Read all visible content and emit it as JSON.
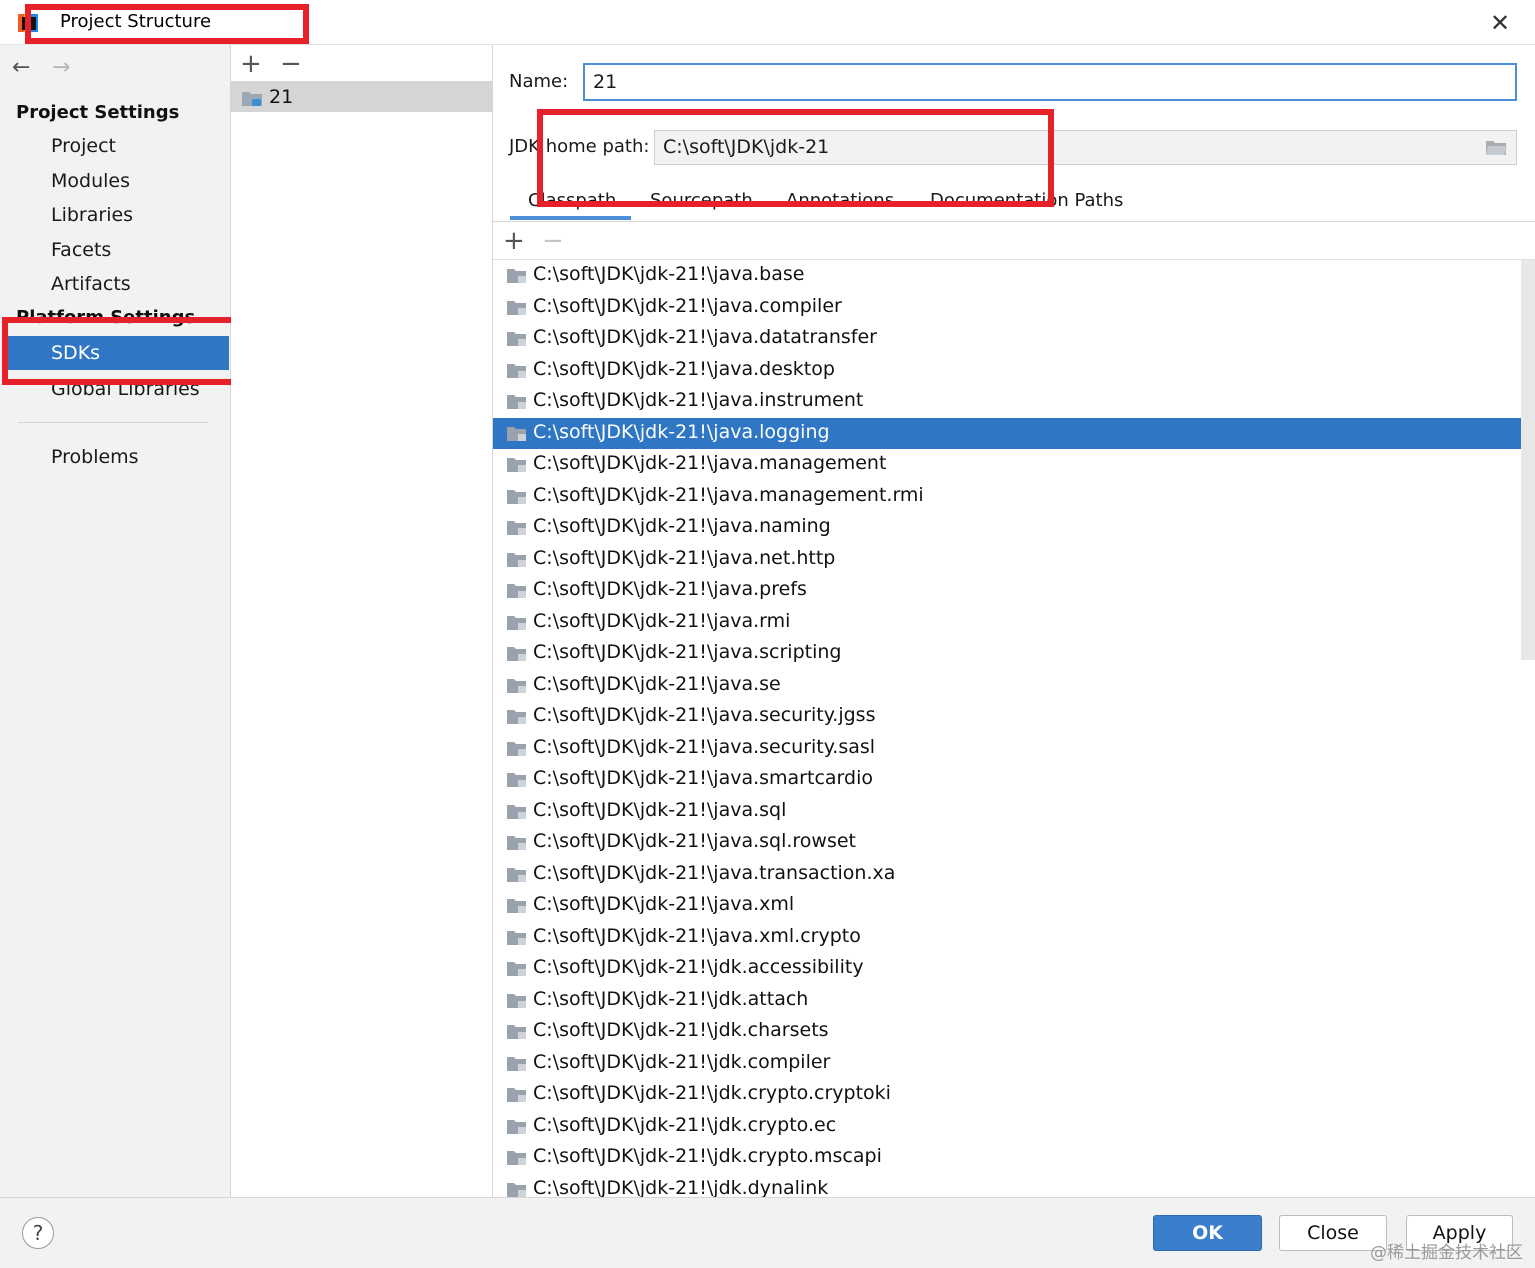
{
  "window": {
    "title": "Project Structure",
    "close_glyph": "✕"
  },
  "nav": {
    "back": "←",
    "forward": "→"
  },
  "sidebar": {
    "project_settings_heading": "Project Settings",
    "items": [
      {
        "label": "Project"
      },
      {
        "label": "Modules"
      },
      {
        "label": "Libraries"
      },
      {
        "label": "Facets"
      },
      {
        "label": "Artifacts"
      }
    ],
    "platform_heading": "Platform Settings",
    "platform_items": [
      {
        "label": "SDKs",
        "selected": true
      },
      {
        "label": "Global Libraries"
      }
    ],
    "problems": "Problems"
  },
  "sdk_list": {
    "add": "+",
    "remove": "−",
    "items": [
      {
        "label": "21"
      }
    ]
  },
  "detail": {
    "name_label": "Name:",
    "name_value": "21",
    "jdk_home_label": "JDK home path:",
    "jdk_home_value": "C:\\soft\\JDK\\jdk-21",
    "tabs": [
      "Classpath",
      "Sourcepath",
      "Annotations",
      "Documentation Paths"
    ],
    "active_tab": "Classpath",
    "list_add": "+",
    "list_remove": "−",
    "classpath": [
      "C:\\soft\\JDK\\jdk-21!\\java.base",
      "C:\\soft\\JDK\\jdk-21!\\java.compiler",
      "C:\\soft\\JDK\\jdk-21!\\java.datatransfer",
      "C:\\soft\\JDK\\jdk-21!\\java.desktop",
      "C:\\soft\\JDK\\jdk-21!\\java.instrument",
      "C:\\soft\\JDK\\jdk-21!\\java.logging",
      "C:\\soft\\JDK\\jdk-21!\\java.management",
      "C:\\soft\\JDK\\jdk-21!\\java.management.rmi",
      "C:\\soft\\JDK\\jdk-21!\\java.naming",
      "C:\\soft\\JDK\\jdk-21!\\java.net.http",
      "C:\\soft\\JDK\\jdk-21!\\java.prefs",
      "C:\\soft\\JDK\\jdk-21!\\java.rmi",
      "C:\\soft\\JDK\\jdk-21!\\java.scripting",
      "C:\\soft\\JDK\\jdk-21!\\java.se",
      "C:\\soft\\JDK\\jdk-21!\\java.security.jgss",
      "C:\\soft\\JDK\\jdk-21!\\java.security.sasl",
      "C:\\soft\\JDK\\jdk-21!\\java.smartcardio",
      "C:\\soft\\JDK\\jdk-21!\\java.sql",
      "C:\\soft\\JDK\\jdk-21!\\java.sql.rowset",
      "C:\\soft\\JDK\\jdk-21!\\java.transaction.xa",
      "C:\\soft\\JDK\\jdk-21!\\java.xml",
      "C:\\soft\\JDK\\jdk-21!\\java.xml.crypto",
      "C:\\soft\\JDK\\jdk-21!\\jdk.accessibility",
      "C:\\soft\\JDK\\jdk-21!\\jdk.attach",
      "C:\\soft\\JDK\\jdk-21!\\jdk.charsets",
      "C:\\soft\\JDK\\jdk-21!\\jdk.compiler",
      "C:\\soft\\JDK\\jdk-21!\\jdk.crypto.cryptoki",
      "C:\\soft\\JDK\\jdk-21!\\jdk.crypto.ec",
      "C:\\soft\\JDK\\jdk-21!\\jdk.crypto.mscapi",
      "C:\\soft\\JDK\\jdk-21!\\jdk.dynalink"
    ],
    "selected_entry": "C:\\soft\\JDK\\jdk-21!\\java.logging"
  },
  "footer": {
    "help": "?",
    "ok": "OK",
    "close": "Close",
    "apply": "Apply"
  },
  "watermark": "@稀土掘金技术社区",
  "colors": {
    "selection": "#2f76c4",
    "annotation_box": "#e8202a",
    "accent": "#4a8fd8"
  }
}
